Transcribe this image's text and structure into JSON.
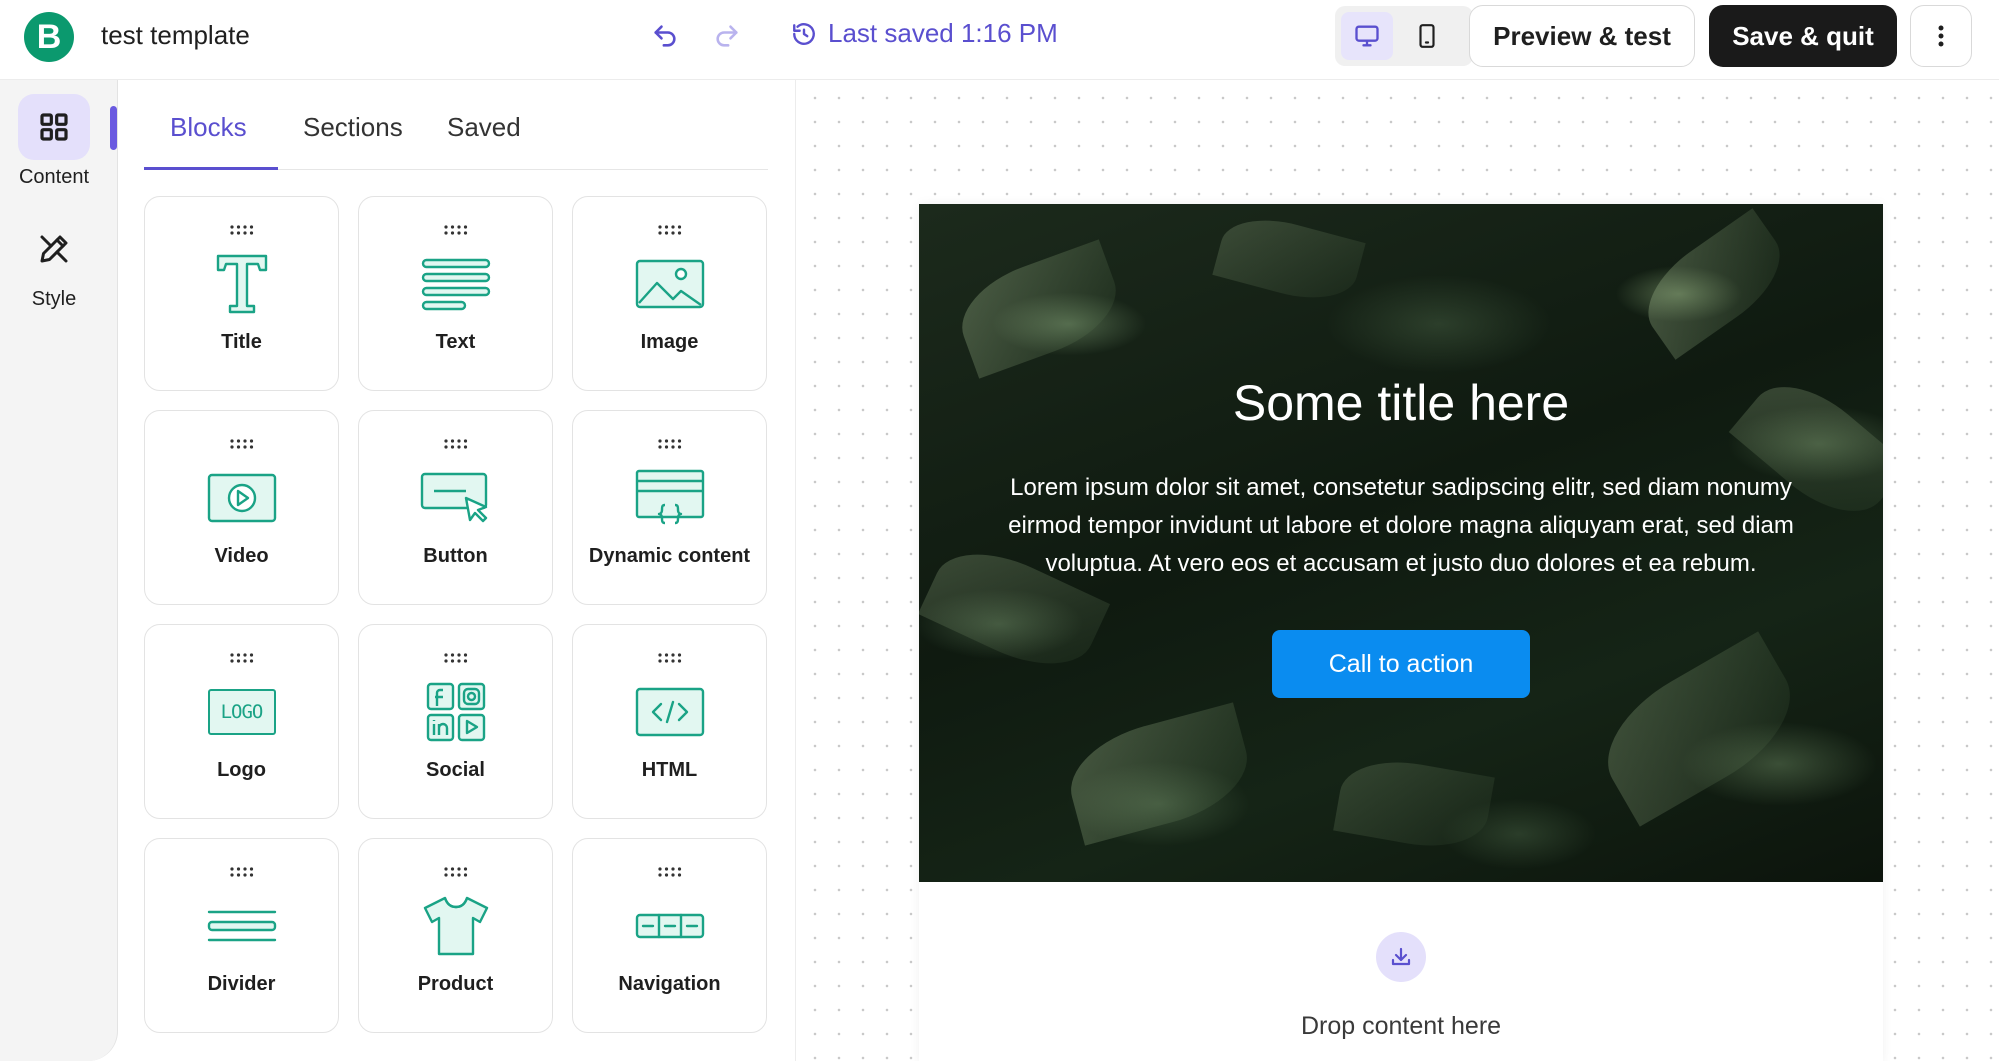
{
  "app": {
    "logo_letter": "B",
    "document_title": "test template"
  },
  "header": {
    "saved_status": "Last saved 1:16 PM",
    "preview_label": "Preview & test",
    "save_label": "Save & quit"
  },
  "rail": {
    "items": [
      {
        "label": "Content",
        "icon": "grid-icon",
        "active": true
      },
      {
        "label": "Style",
        "icon": "brush-ruler-icon",
        "active": false
      }
    ]
  },
  "panel": {
    "tabs": [
      {
        "label": "Blocks",
        "active": true
      },
      {
        "label": "Sections",
        "active": false
      },
      {
        "label": "Saved",
        "active": false
      }
    ],
    "blocks": [
      {
        "label": "Title",
        "icon": "title-icon"
      },
      {
        "label": "Text",
        "icon": "text-icon"
      },
      {
        "label": "Image",
        "icon": "image-icon"
      },
      {
        "label": "Video",
        "icon": "video-icon"
      },
      {
        "label": "Button",
        "icon": "button-icon"
      },
      {
        "label": "Dynamic content",
        "icon": "dynamic-content-icon"
      },
      {
        "label": "Logo",
        "icon": "logo-icon",
        "icon_text": "LOGO"
      },
      {
        "label": "Social",
        "icon": "social-icon"
      },
      {
        "label": "HTML",
        "icon": "html-icon"
      },
      {
        "label": "Divider",
        "icon": "divider-icon"
      },
      {
        "label": "Product",
        "icon": "product-icon"
      },
      {
        "label": "Navigation",
        "icon": "navigation-icon"
      }
    ]
  },
  "email": {
    "hero": {
      "title": "Some title here",
      "body": "Lorem ipsum dolor sit amet, consetetur sadipscing elitr, sed diam nonumy eirmod tempor invidunt ut labore et dolore magna aliquyam erat, sed diam voluptua. At vero eos et accusam et justo duo dolores et ea rebum.",
      "cta_label": "Call to action"
    },
    "drop_zone_text": "Drop content here"
  },
  "colors": {
    "accent": "#5a4fcf",
    "brand_green": "#0b996e",
    "icon_teal": "#1aa386",
    "cta_blue": "#0a8cf0",
    "save_button": "#1a1a1a"
  }
}
